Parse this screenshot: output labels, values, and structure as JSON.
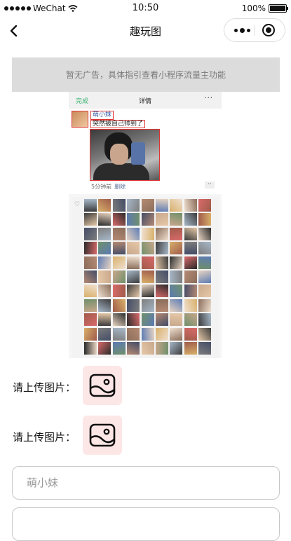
{
  "status_bar": {
    "carrier": "WeChat",
    "time": "10:50",
    "battery": "100%"
  },
  "nav": {
    "title": "趣玩图"
  },
  "ad": {
    "text": "暂无广告，具体指引查看小程序流量主功能"
  },
  "preview": {
    "header_done": "完成",
    "header_title": "详情",
    "header_more": "···",
    "username": "萌小妹",
    "post_text": "突然被自己帅到了",
    "post_time": "5分钟前",
    "post_delete": "删除",
    "post_more": "··",
    "like_icon": "heart-icon"
  },
  "upload": {
    "rows": [
      {
        "label": "请上传图片：",
        "icon": "image-icon"
      },
      {
        "label": "请上传图片：",
        "icon": "image-icon"
      }
    ]
  },
  "form": {
    "name_placeholder": "萌小妹",
    "second_placeholder": ""
  },
  "colors": {
    "ad_background": "#dcdcdc",
    "upload_background": "#fde6e6",
    "highlight_border": "#dd3333",
    "done_green": "#3cb371"
  }
}
